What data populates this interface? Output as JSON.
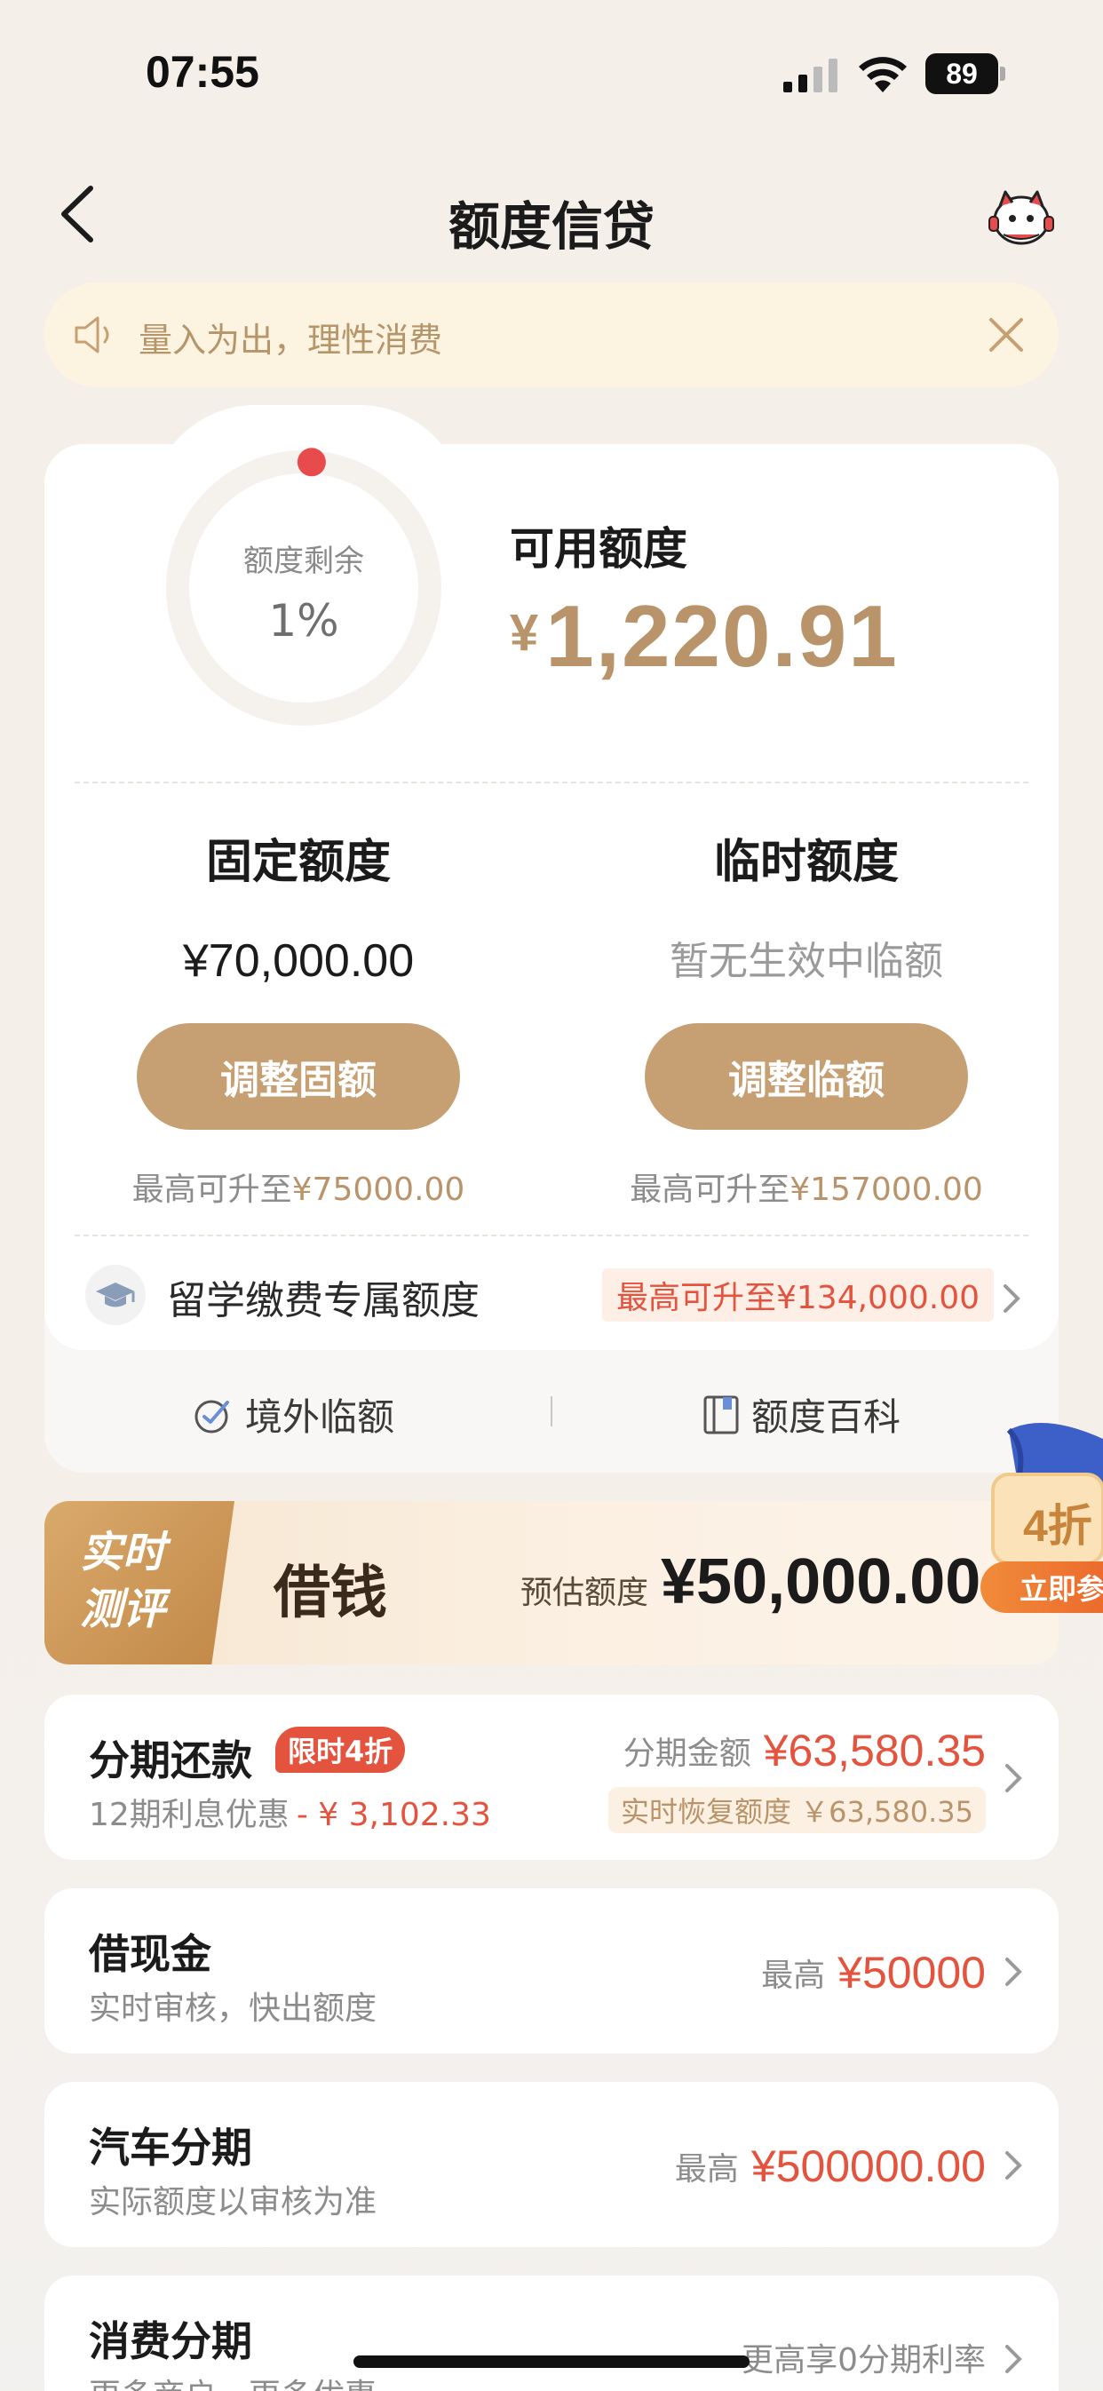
{
  "status": {
    "time": "07:55",
    "battery": "89"
  },
  "nav": {
    "title": "额度信贷"
  },
  "notice": {
    "text": "量入为出，理性消费"
  },
  "credit": {
    "remaining_label": "额度剩余",
    "remaining_percent": "1%",
    "remaining_fraction": 0.01,
    "available_title": "可用额度",
    "available_currency": "¥",
    "available_amount": "1,220.91",
    "fixed": {
      "title": "固定额度",
      "value": "¥70,000.00",
      "button": "调整固额",
      "max_prefix": "最高可升至",
      "max_value": "¥75000.00"
    },
    "temp": {
      "title": "临时额度",
      "value": "暂无生效中临额",
      "button": "调整临额",
      "max_prefix": "最高可升至",
      "max_value": "¥157000.00"
    },
    "study": {
      "label": "留学缴费专属额度",
      "badge": "最高可升至¥134,000.00"
    },
    "footer": {
      "overseas": "境外临额",
      "wiki": "额度百科"
    }
  },
  "banner": {
    "tag_line1": "实时",
    "tag_line2": "测评",
    "title": "借钱",
    "estimate_label": "预估额度",
    "estimate_amount": "¥50,000.00",
    "gift_discount": "4折",
    "gift_button": "立即参"
  },
  "items": {
    "installment": {
      "title": "分期还款",
      "badge": "限时4折",
      "sub_prefix": "12期利息优惠",
      "sub_value": "- ¥ 3,102.33",
      "amount_label": "分期金额",
      "amount": "¥63,580.35",
      "recover": "实时恢复额度 ￥63,580.35"
    },
    "cash": {
      "title": "借现金",
      "sub": "实时审核，快出额度",
      "label": "最高",
      "amount": "¥50000"
    },
    "car": {
      "title": "汽车分期",
      "sub": "实际额度以审核为准",
      "label": "最高",
      "amount": "¥500000.00"
    },
    "consume": {
      "title": "消费分期",
      "sub": "更多商户，更多优惠",
      "right": "更高享0分期利率"
    }
  },
  "colors": {
    "accent": "#c6a073",
    "amount_gold": "#b9946a",
    "red": "#e4533e",
    "ring_dot": "#e84b4b"
  }
}
